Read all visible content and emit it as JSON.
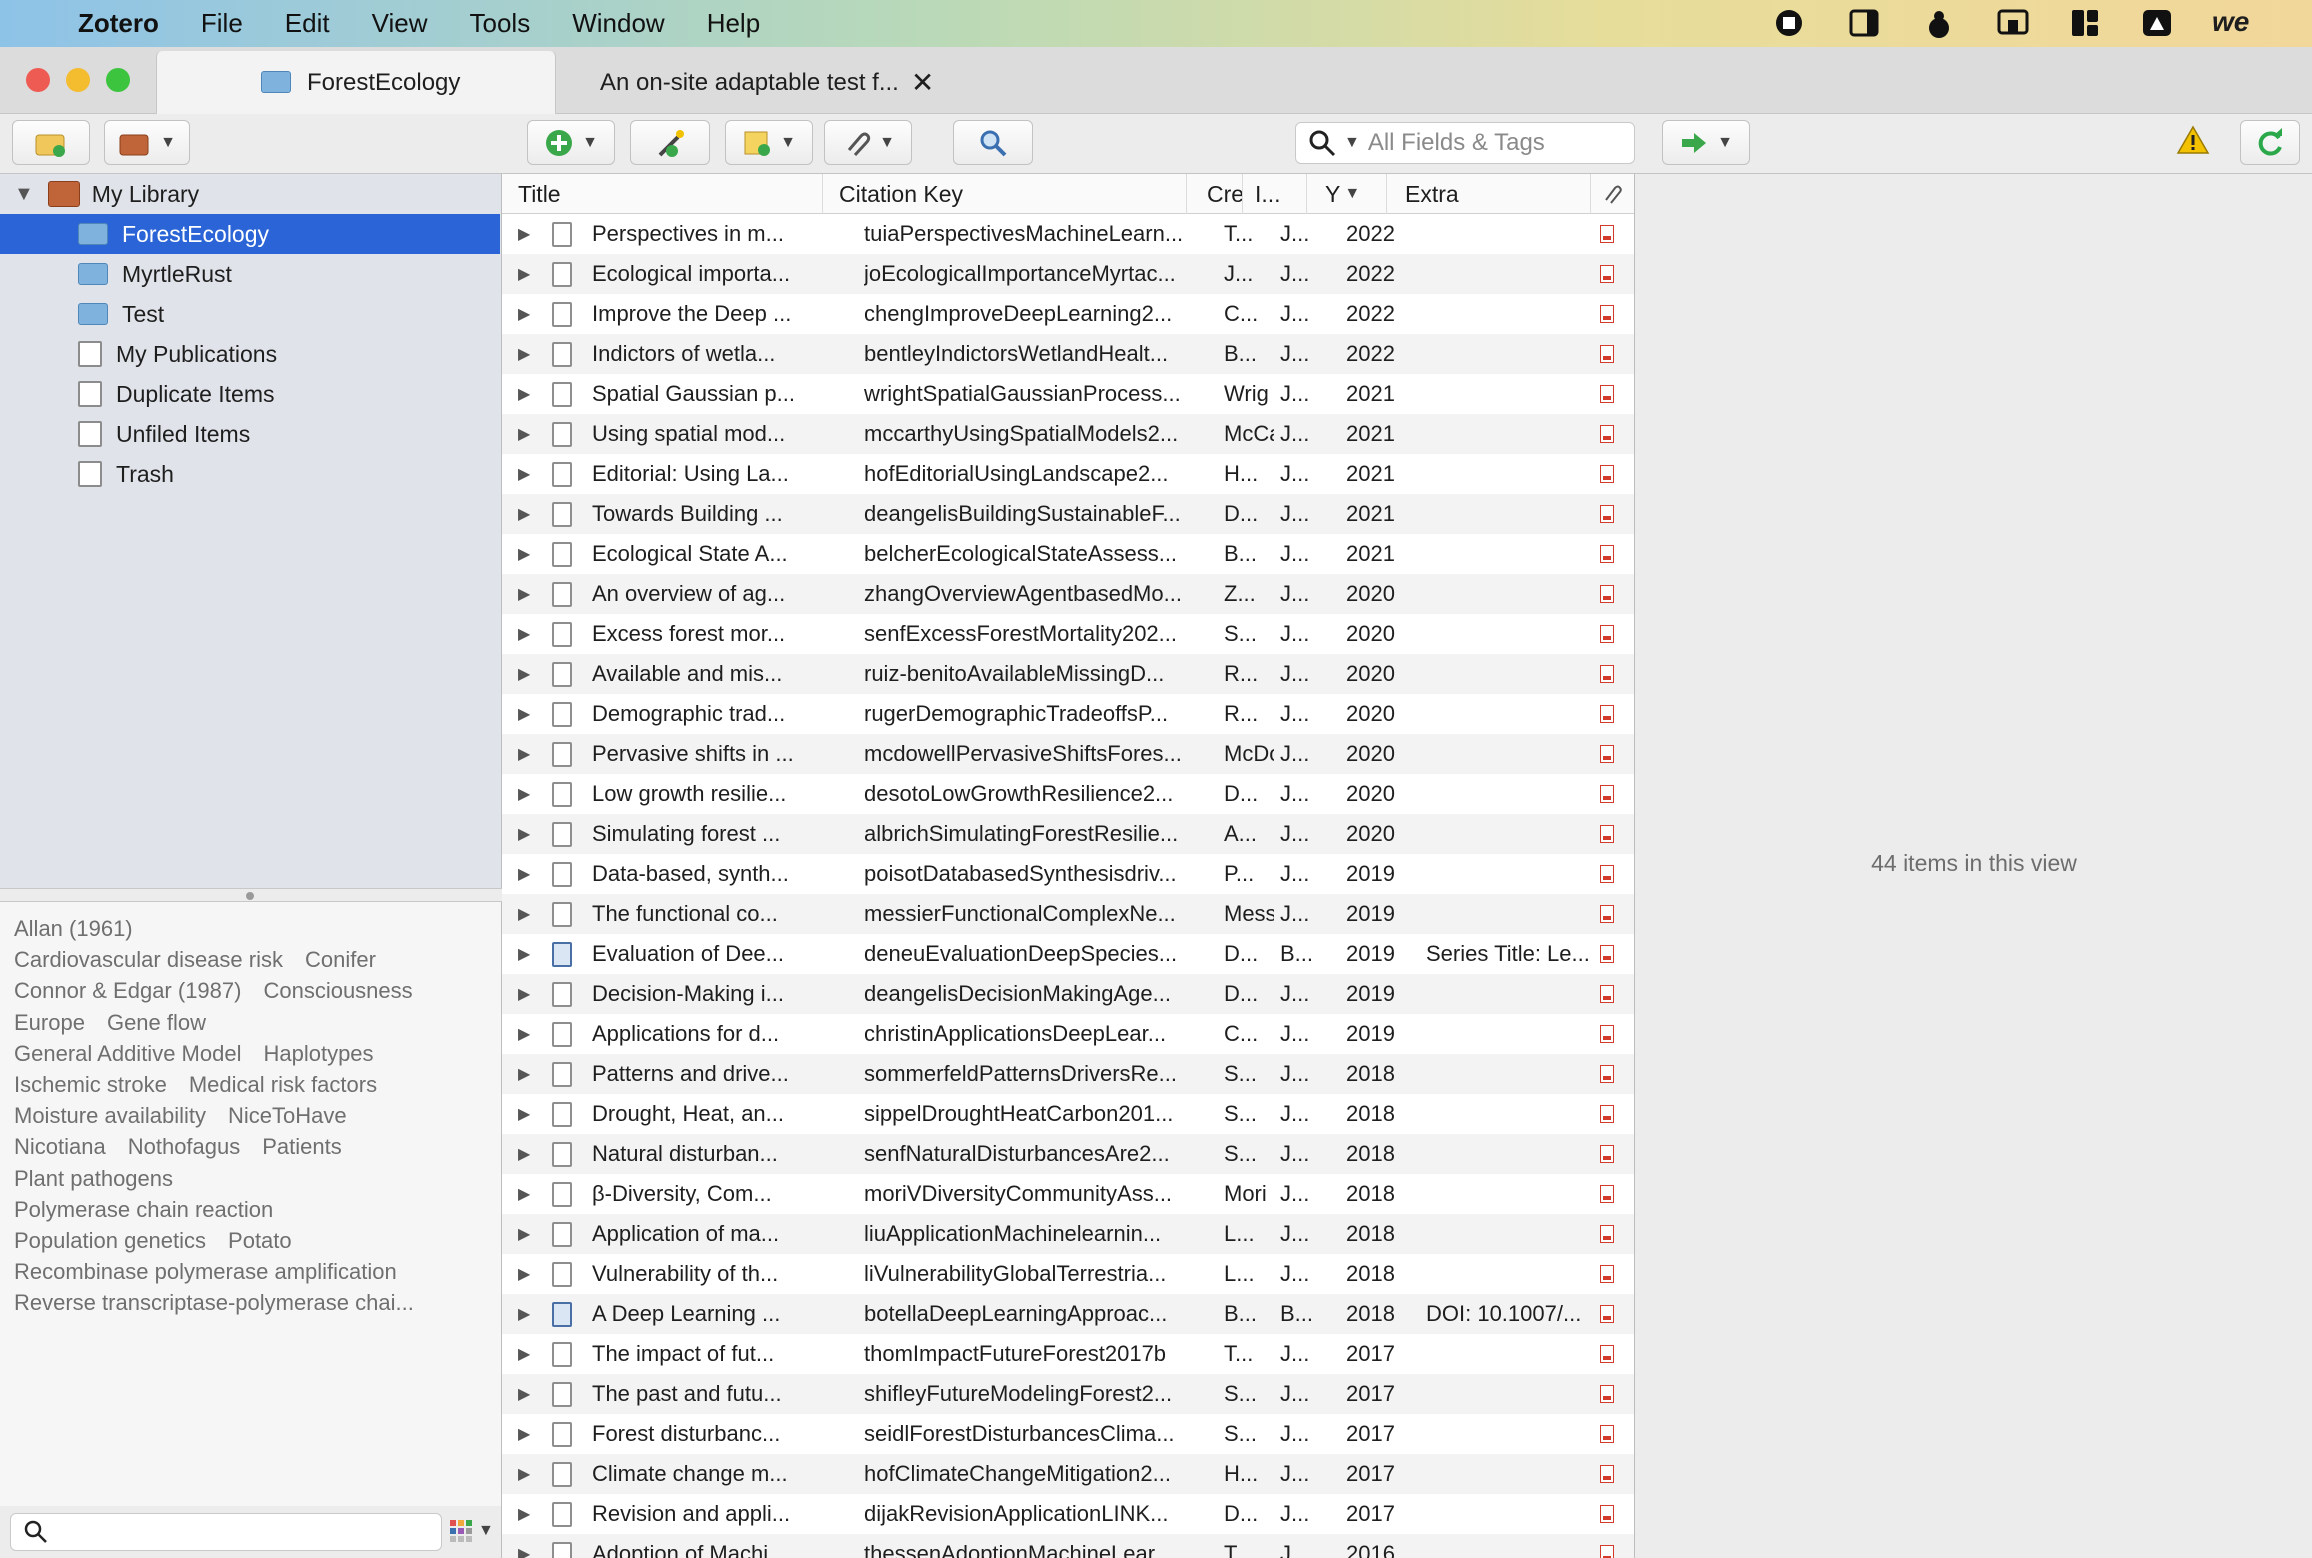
{
  "menubar": {
    "app_name": "Zotero",
    "menus": [
      "File",
      "Edit",
      "View",
      "Tools",
      "Window",
      "Help"
    ]
  },
  "tabs": [
    {
      "label": "ForestEcology",
      "icon": "folder-icon"
    },
    {
      "label": "An on-site adaptable test f...",
      "icon": "close-icon"
    }
  ],
  "toolbar": {
    "search_placeholder": "All Fields & Tags"
  },
  "library": {
    "root": "My Library",
    "collections": [
      {
        "label": "ForestEcology",
        "icon": "folder-icon",
        "selected": true
      },
      {
        "label": "MyrtleRust",
        "icon": "folder-icon"
      },
      {
        "label": "Test",
        "icon": "folder-icon"
      },
      {
        "label": "My Publications",
        "icon": "document-icon"
      },
      {
        "label": "Duplicate Items",
        "icon": "duplicate-icon"
      },
      {
        "label": "Unfiled Items",
        "icon": "unfiled-icon"
      },
      {
        "label": "Trash",
        "icon": "trash-icon"
      }
    ]
  },
  "tags": [
    [
      "Allan (1961)"
    ],
    [
      "Cardiovascular disease risk",
      "Conifer"
    ],
    [
      "Connor & Edgar (1987)",
      "Consciousness"
    ],
    [
      "Europe",
      "Gene flow"
    ],
    [
      "General Additive Model",
      "Haplotypes"
    ],
    [
      "Ischemic stroke",
      "Medical risk factors"
    ],
    [
      "Moisture availability",
      "NiceToHave"
    ],
    [
      "Nicotiana",
      "Nothofagus",
      "Patients"
    ],
    [
      "Plant pathogens"
    ],
    [
      "Polymerase chain reaction"
    ],
    [
      "Population genetics",
      "Potato"
    ],
    [
      "Recombinase polymerase amplification"
    ],
    [
      "Reverse transcriptase-polymerase chai..."
    ]
  ],
  "columns": {
    "title": "Title",
    "citation_key": "Citation Key",
    "creator": "Cre",
    "item_type": "I...",
    "year": "Y",
    "extra": "Extra"
  },
  "items": [
    {
      "title": "Perspectives in m...",
      "key": "tuiaPerspectivesMachineLearn...",
      "creator": "T...",
      "type": "J...",
      "year": "2022",
      "extra": "",
      "kind": "article"
    },
    {
      "title": "Ecological importa...",
      "key": "joEcologicalImportanceMyrtac...",
      "creator": "J...",
      "type": "J...",
      "year": "2022",
      "extra": "",
      "kind": "article"
    },
    {
      "title": "Improve the Deep ...",
      "key": "chengImproveDeepLearning2...",
      "creator": "C...",
      "type": "J...",
      "year": "2022",
      "extra": "",
      "kind": "article"
    },
    {
      "title": "Indictors of wetla...",
      "key": "bentleyIndictorsWetlandHealt...",
      "creator": "B...",
      "type": "J...",
      "year": "2022",
      "extra": "",
      "kind": "article"
    },
    {
      "title": "Spatial Gaussian p...",
      "key": "wrightSpatialGaussianProcess...",
      "creator": "Wrig",
      "type": "J...",
      "year": "2021",
      "extra": "",
      "kind": "article"
    },
    {
      "title": "Using spatial mod...",
      "key": "mccarthyUsingSpatialModels2...",
      "creator": "McCa",
      "type": "J...",
      "year": "2021",
      "extra": "",
      "kind": "article"
    },
    {
      "title": "Editorial: Using La...",
      "key": "hofEditorialUsingLandscape2...",
      "creator": "H...",
      "type": "J...",
      "year": "2021",
      "extra": "",
      "kind": "article"
    },
    {
      "title": "Towards Building ...",
      "key": "deangelisBuildingSustainableF...",
      "creator": "D...",
      "type": "J...",
      "year": "2021",
      "extra": "",
      "kind": "article"
    },
    {
      "title": "Ecological State A...",
      "key": "belcherEcologicalStateAssess...",
      "creator": "B...",
      "type": "J...",
      "year": "2021",
      "extra": "",
      "kind": "article"
    },
    {
      "title": "An overview of ag...",
      "key": "zhangOverviewAgentbasedMo...",
      "creator": "Z...",
      "type": "J...",
      "year": "2020",
      "extra": "",
      "kind": "article"
    },
    {
      "title": "Excess forest mor...",
      "key": "senfExcessForestMortality202...",
      "creator": "S...",
      "type": "J...",
      "year": "2020",
      "extra": "",
      "kind": "article"
    },
    {
      "title": "Available and mis...",
      "key": "ruiz-benitoAvailableMissingD...",
      "creator": "R...",
      "type": "J...",
      "year": "2020",
      "extra": "",
      "kind": "article"
    },
    {
      "title": "Demographic trad...",
      "key": "rugerDemographicTradeoffsP...",
      "creator": "R...",
      "type": "J...",
      "year": "2020",
      "extra": "",
      "kind": "article"
    },
    {
      "title": "Pervasive shifts in ...",
      "key": "mcdowellPervasiveShiftsFores...",
      "creator": "McDo",
      "type": "J...",
      "year": "2020",
      "extra": "",
      "kind": "article"
    },
    {
      "title": "Low growth resilie...",
      "key": "desotoLowGrowthResilience2...",
      "creator": "D...",
      "type": "J...",
      "year": "2020",
      "extra": "",
      "kind": "article"
    },
    {
      "title": "Simulating forest ...",
      "key": "albrichSimulatingForestResilie...",
      "creator": "A...",
      "type": "J...",
      "year": "2020",
      "extra": "",
      "kind": "article"
    },
    {
      "title": "Data-based, synth...",
      "key": "poisotDatabasedSynthesisdriv...",
      "creator": "P...",
      "type": "J...",
      "year": "2019",
      "extra": "",
      "kind": "article"
    },
    {
      "title": "The functional co...",
      "key": "messierFunctionalComplexNe...",
      "creator": "Mess",
      "type": "J...",
      "year": "2019",
      "extra": "",
      "kind": "article"
    },
    {
      "title": "Evaluation of Dee...",
      "key": "deneuEvaluationDeepSpecies...",
      "creator": "D...",
      "type": "B...",
      "year": "2019",
      "extra": "Series Title: Le...",
      "kind": "book"
    },
    {
      "title": "Decision-Making i...",
      "key": "deangelisDecisionMakingAge...",
      "creator": "D...",
      "type": "J...",
      "year": "2019",
      "extra": "",
      "kind": "article"
    },
    {
      "title": "Applications for d...",
      "key": "christinApplicationsDeepLear...",
      "creator": "C...",
      "type": "J...",
      "year": "2019",
      "extra": "",
      "kind": "article"
    },
    {
      "title": "Patterns and drive...",
      "key": "sommerfeldPatternsDriversRe...",
      "creator": "S...",
      "type": "J...",
      "year": "2018",
      "extra": "",
      "kind": "article"
    },
    {
      "title": "Drought, Heat, an...",
      "key": "sippelDroughtHeatCarbon201...",
      "creator": "S...",
      "type": "J...",
      "year": "2018",
      "extra": "",
      "kind": "article"
    },
    {
      "title": "Natural disturban...",
      "key": "senfNaturalDisturbancesAre2...",
      "creator": "S...",
      "type": "J...",
      "year": "2018",
      "extra": "",
      "kind": "article"
    },
    {
      "title": "β-Diversity, Com...",
      "key": "moriVDiversityCommunityAss...",
      "creator": "Mori",
      "type": "J...",
      "year": "2018",
      "extra": "",
      "kind": "article"
    },
    {
      "title": "Application of ma...",
      "key": "liuApplicationMachinelearnin...",
      "creator": "L...",
      "type": "J...",
      "year": "2018",
      "extra": "",
      "kind": "article"
    },
    {
      "title": "Vulnerability of th...",
      "key": "liVulnerabilityGlobalTerrestria...",
      "creator": "L...",
      "type": "J...",
      "year": "2018",
      "extra": "",
      "kind": "article"
    },
    {
      "title": "A Deep Learning ...",
      "key": "botellaDeepLearningApproac...",
      "creator": "B...",
      "type": "B...",
      "year": "2018",
      "extra": "DOI: 10.1007/...",
      "kind": "book"
    },
    {
      "title": "The impact of fut...",
      "key": "thomImpactFutureForest2017b",
      "creator": "T...",
      "type": "J...",
      "year": "2017",
      "extra": "",
      "kind": "article"
    },
    {
      "title": "The past and futu...",
      "key": "shifleyFutureModelingForest2...",
      "creator": "S...",
      "type": "J...",
      "year": "2017",
      "extra": "",
      "kind": "article"
    },
    {
      "title": "Forest disturbanc...",
      "key": "seidlForestDisturbancesClima...",
      "creator": "S...",
      "type": "J...",
      "year": "2017",
      "extra": "",
      "kind": "article"
    },
    {
      "title": "Climate change m...",
      "key": "hofClimateChangeMitigation2...",
      "creator": "H...",
      "type": "J...",
      "year": "2017",
      "extra": "",
      "kind": "article"
    },
    {
      "title": "Revision and appli...",
      "key": "dijakRevisionApplicationLINK...",
      "creator": "D...",
      "type": "J...",
      "year": "2017",
      "extra": "",
      "kind": "article"
    },
    {
      "title": "Adoption of Machi...",
      "key": "thessenAdoptionMachineLear...",
      "creator": "T...",
      "type": "J...",
      "year": "2016",
      "extra": "",
      "kind": "article"
    }
  ],
  "item_pane": {
    "count_text": "44 items in this view"
  },
  "colors": {
    "selection": "#2a64d6",
    "pdf_red": "#d23a2a",
    "sync_green": "#2aa84a",
    "warning_yellow": "#f2c200"
  }
}
